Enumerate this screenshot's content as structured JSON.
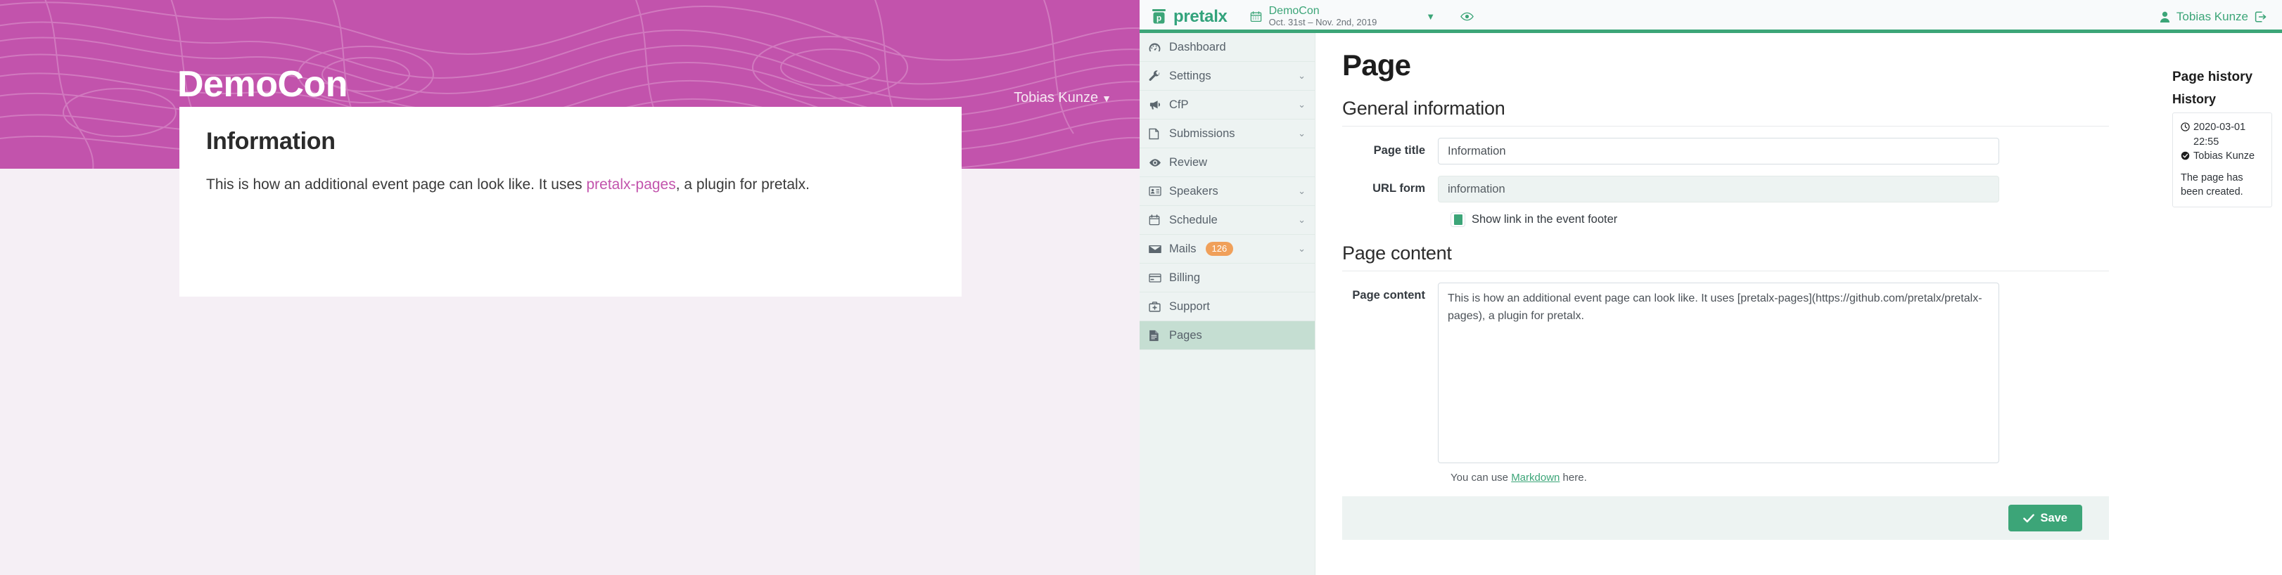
{
  "preview": {
    "event_title": "DemoCon",
    "user": "Tobias Kunze",
    "user_caret": "caret-down-icon",
    "card_title": "Information",
    "card_text_before": "This is how an additional event page can look like. It uses ",
    "card_link": "pretalx-pages",
    "card_text_after": ", a plugin for pretalx.",
    "hero_color": "#C253AC",
    "page_bg": "#F5EFF5",
    "link_color": "#C253AC"
  },
  "topbar": {
    "logo_icon": "pretalx-logo-icon",
    "brand": "pretalx",
    "calendar_icon": "calendar-icon",
    "event_name": "DemoCon",
    "event_dates": "Oct. 31st – Nov. 2nd, 2019",
    "event_caret_icon": "caret-down-icon",
    "preview_eye_icon": "eye-icon",
    "user_icon": "user-icon",
    "user_name": "Tobias Kunze",
    "logout_icon": "logout-icon",
    "accent": "#3CA578"
  },
  "sidebar": {
    "active": "Pages",
    "items": [
      {
        "label": "Dashboard",
        "icon": "dashboard-icon",
        "expandable": false,
        "badge": null
      },
      {
        "label": "Settings",
        "icon": "wrench-icon",
        "expandable": true,
        "badge": null
      },
      {
        "label": "CfP",
        "icon": "megaphone-icon",
        "expandable": true,
        "badge": null
      },
      {
        "label": "Submissions",
        "icon": "document-icon",
        "expandable": true,
        "badge": null
      },
      {
        "label": "Review",
        "icon": "eye-icon",
        "expandable": false,
        "badge": null
      },
      {
        "label": "Speakers",
        "icon": "id-card-icon",
        "expandable": true,
        "badge": null
      },
      {
        "label": "Schedule",
        "icon": "calendar-icon",
        "expandable": true,
        "badge": null
      },
      {
        "label": "Mails",
        "icon": "envelope-icon",
        "expandable": true,
        "badge": "126"
      },
      {
        "label": "Billing",
        "icon": "credit-card-icon",
        "expandable": false,
        "badge": null
      },
      {
        "label": "Support",
        "icon": "first-aid-icon",
        "expandable": false,
        "badge": null
      },
      {
        "label": "Pages",
        "icon": "page-file-icon",
        "expandable": false,
        "badge": null
      }
    ],
    "badge_color": "#F0A05A",
    "active_bg": "#C5DED2"
  },
  "main": {
    "page_title": "Page",
    "general_section": {
      "heading": "General information",
      "page_title_label": "Page title",
      "page_title_value": "Information",
      "url_form_label": "URL form",
      "url_form_value": "information",
      "checkbox_label": "Show link in the event footer",
      "checkbox_checked": true
    },
    "content_section": {
      "heading": "Page content",
      "content_label": "Page content",
      "content_value": "This is how an additional event page can look like. It uses [pretalx-pages](https://github.com/pretalx/pretalx-pages), a plugin for pretalx.",
      "help_before": "You can use ",
      "help_link": "Markdown",
      "help_after": " here."
    },
    "save_label": "Save",
    "save_icon": "check-icon"
  },
  "history": {
    "title": "Page history",
    "subtitle": "History",
    "clock_icon": "clock-icon",
    "timestamp": "2020-03-01 22:55",
    "user_icon": "check-circle-icon",
    "user": "Tobias Kunze",
    "body": "The page has been created."
  }
}
